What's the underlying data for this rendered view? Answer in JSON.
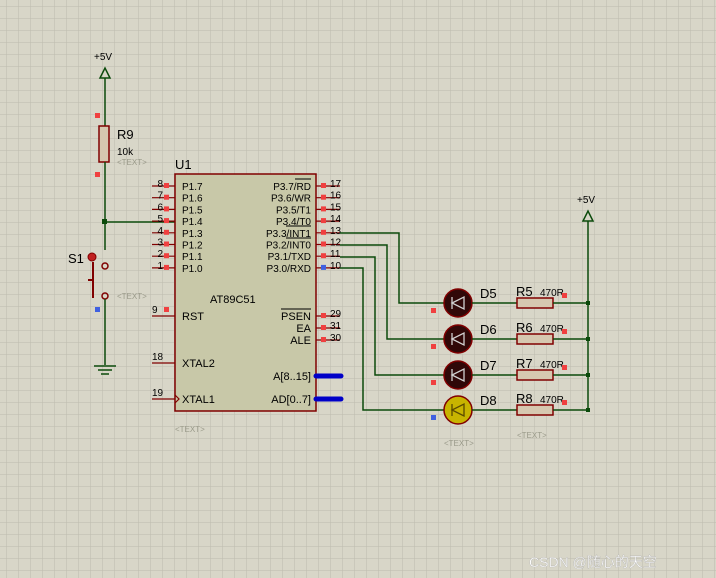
{
  "power": {
    "label_left": "+5V",
    "label_right": "+5V"
  },
  "r9": {
    "ref": "R9",
    "value": "10k",
    "text": "<TEXT>"
  },
  "s1": {
    "ref": "S1",
    "text": "<TEXT>"
  },
  "u1": {
    "ref": "U1",
    "part": "AT89C51",
    "text": "<TEXT>",
    "left_pins": [
      {
        "num": "8",
        "name": "P1.7"
      },
      {
        "num": "7",
        "name": "P1.6"
      },
      {
        "num": "6",
        "name": "P1.5"
      },
      {
        "num": "5",
        "name": "P1.4"
      },
      {
        "num": "4",
        "name": "P1.3"
      },
      {
        "num": "3",
        "name": "P1.2"
      },
      {
        "num": "2",
        "name": "P1.1"
      },
      {
        "num": "1",
        "name": "P1.0"
      }
    ],
    "right_pins": [
      {
        "num": "17",
        "name": "P3.7/RD"
      },
      {
        "num": "16",
        "name": "P3.6/WR"
      },
      {
        "num": "15",
        "name": "P3.5/T1"
      },
      {
        "num": "14",
        "name": "P3.4/T0"
      },
      {
        "num": "13",
        "name": "P3.3/INT1"
      },
      {
        "num": "12",
        "name": "P3.2/INT0"
      },
      {
        "num": "11",
        "name": "P3.1/TXD"
      },
      {
        "num": "10",
        "name": "P3.0/RXD"
      }
    ],
    "rst": {
      "num": "9",
      "name": "RST"
    },
    "xtal2": {
      "num": "18",
      "name": "XTAL2"
    },
    "xtal1": {
      "num": "19",
      "name": "XTAL1"
    },
    "psen": {
      "num": "29",
      "name": "PSEN"
    },
    "ea": {
      "num": "31",
      "name": "EA"
    },
    "ale": {
      "num": "30",
      "name": "ALE"
    },
    "bus_hi": "A[8..15]",
    "bus_lo": "AD[0..7]"
  },
  "leds": [
    {
      "ref": "D5",
      "resistor": "R5",
      "value": "470R",
      "lit": false
    },
    {
      "ref": "D6",
      "resistor": "R6",
      "value": "470R",
      "lit": false
    },
    {
      "ref": "D7",
      "resistor": "R7",
      "value": "470R",
      "lit": false
    },
    {
      "ref": "D8",
      "resistor": "R8",
      "value": "470R",
      "lit": true
    }
  ],
  "led_text": "<TEXT>",
  "res_text": "<TEXT>",
  "watermark": "CSDN @随心的天空",
  "colors": {
    "wire": "#0b4a0b",
    "pin": "#800000",
    "chip_fill": "#c8c8a8",
    "led_off": "#300808",
    "led_on": "#c8b400",
    "resistor_fill": "#d6c8b0",
    "bus": "#0000c8",
    "marker_red": "#f04040",
    "marker_blue": "#4060e0",
    "grid": "#bdbbae"
  }
}
